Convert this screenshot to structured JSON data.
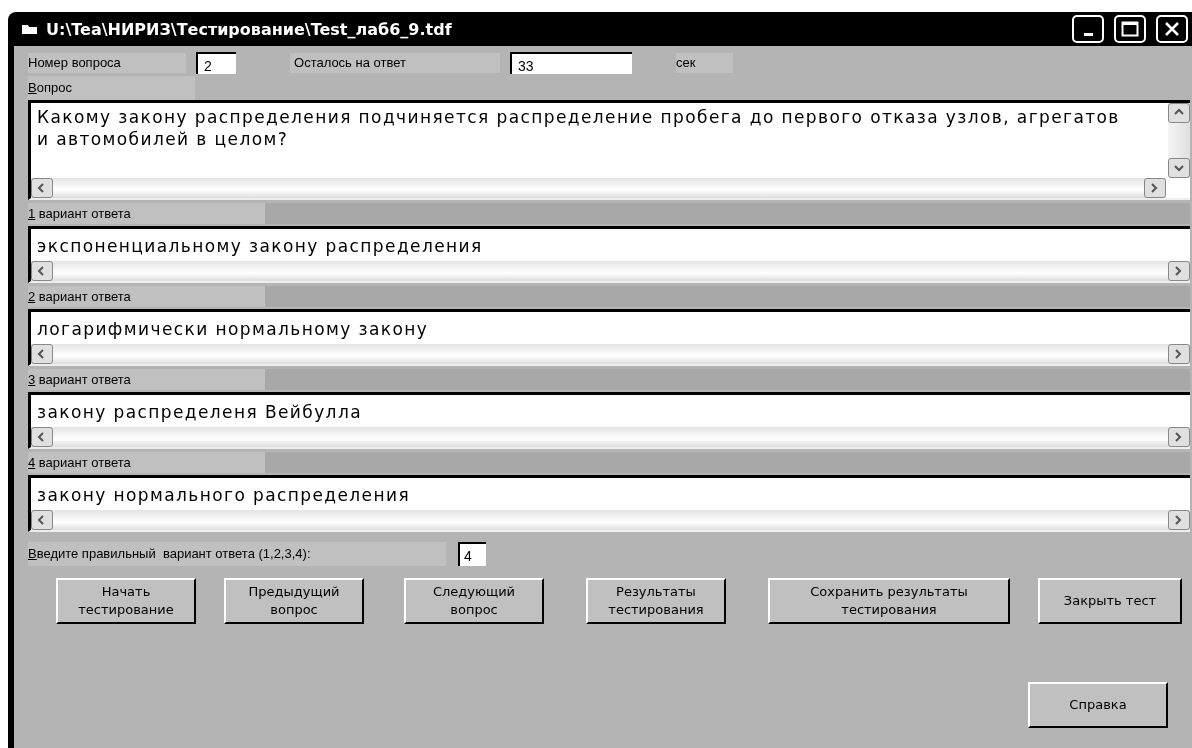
{
  "window": {
    "title": "U:\\Tea\\НИРИЗ\\Тестирование\\Test_лаб6_9.tdf"
  },
  "header": {
    "question_number_label": "Номер вопроса",
    "question_number": "2",
    "time_label": "Осталось на ответ",
    "time_value": "33",
    "time_unit": "сек"
  },
  "question": {
    "label": "Вопрос",
    "text": "Какому закону распределения подчиняется распределение пробега до первого отказа узлов, агрегатов и автомобилей в целом?"
  },
  "answers": [
    {
      "label": "1 вариант ответа",
      "text": "экспоненциальному закону распределения"
    },
    {
      "label": "2 вариант ответа",
      "text": "логарифмически нормальному закону"
    },
    {
      "label": "3 вариант ответа",
      "text": "закону распределеня Вейбулла"
    },
    {
      "label": "4 вариант ответа",
      "text": "закону нормального распределения"
    }
  ],
  "answer_input": {
    "label": "Введите правильный  вариант ответа (1,2,3,4):",
    "value": "4"
  },
  "buttons": [
    {
      "label": "Начать\nтестирование"
    },
    {
      "label": "Предыдущий\nвопрос"
    },
    {
      "label": "Следующий\nвопрос"
    },
    {
      "label": "Результаты\nтестирования"
    },
    {
      "label": "Сохранить результаты\nтестирования"
    },
    {
      "label": "Закрыть тест"
    }
  ],
  "help_button": {
    "label": "Справка"
  }
}
